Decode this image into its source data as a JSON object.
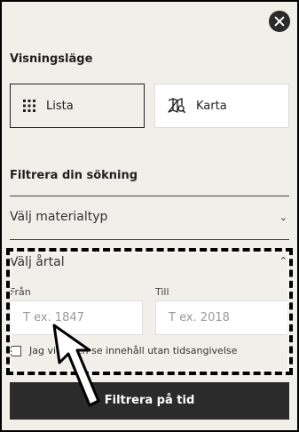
{
  "close": {
    "icon": "close-icon"
  },
  "view_mode": {
    "heading": "Visningsläge",
    "options": [
      {
        "label": "Lista",
        "icon": "grid-icon",
        "selected": true
      },
      {
        "label": "Karta",
        "icon": "map-search-icon",
        "selected": false
      }
    ]
  },
  "filter": {
    "heading": "Filtrera din sökning",
    "material_type": {
      "label": "Välj materialtyp",
      "icon": "chevron-down-icon"
    },
    "year": {
      "label": "Välj årtal",
      "icon": "chevron-up-icon",
      "from_label": "Från",
      "from_placeholder": "T ex. 1847",
      "to_label": "Till",
      "to_placeholder": "T ex. 2018",
      "checkbox_label": "Jag vill även se innehåll utan tidsangivelse",
      "checkbox_checked": false
    },
    "submit_label": "Filtrera på tid"
  }
}
